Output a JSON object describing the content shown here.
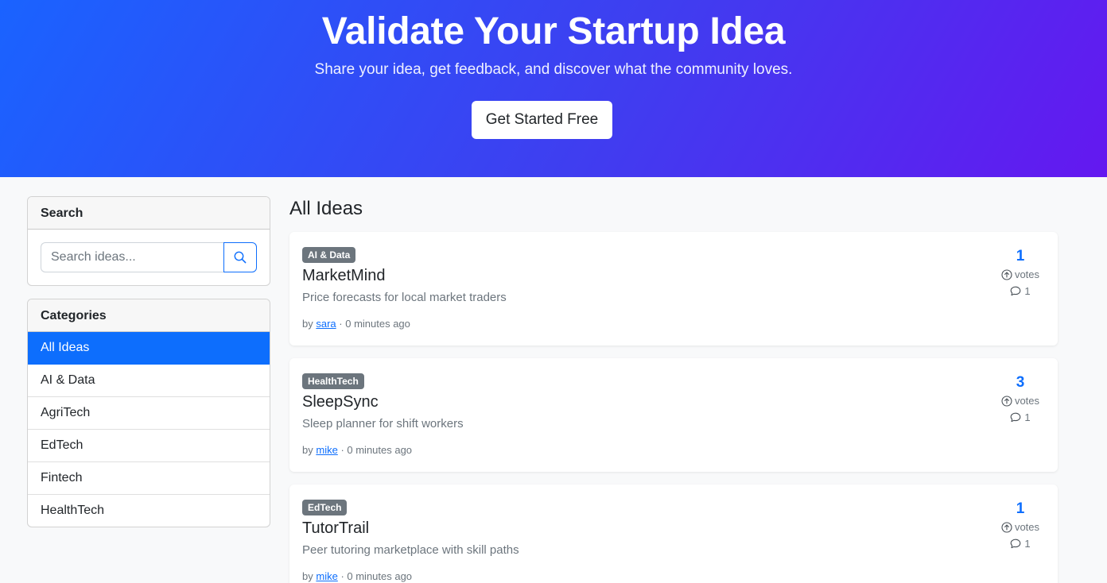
{
  "hero": {
    "title": "Validate Your Startup Idea",
    "subtitle": "Share your idea, get feedback, and discover what the community loves.",
    "cta_label": "Get Started Free"
  },
  "search": {
    "heading": "Search",
    "placeholder": "Search ideas...",
    "icon": "search-icon"
  },
  "categories": {
    "heading": "Categories",
    "items": [
      {
        "label": "All Ideas",
        "active": true
      },
      {
        "label": "AI & Data",
        "active": false
      },
      {
        "label": "AgriTech",
        "active": false
      },
      {
        "label": "EdTech",
        "active": false
      },
      {
        "label": "Fintech",
        "active": false
      },
      {
        "label": "HealthTech",
        "active": false
      }
    ]
  },
  "main": {
    "title": "All Ideas",
    "ideas": [
      {
        "category": "AI & Data",
        "title": "MarketMind",
        "description": "Price forecasts for local market traders",
        "by": "by",
        "author": "sara",
        "time": "· 0 minutes ago",
        "votes": "1",
        "votes_label": "votes",
        "comments": "1"
      },
      {
        "category": "HealthTech",
        "title": "SleepSync",
        "description": "Sleep planner for shift workers",
        "by": "by",
        "author": "mike",
        "time": "· 0 minutes ago",
        "votes": "3",
        "votes_label": "votes",
        "comments": "1"
      },
      {
        "category": "EdTech",
        "title": "TutorTrail",
        "description": "Peer tutoring marketplace with skill paths",
        "by": "by",
        "author": "mike",
        "time": "· 0 minutes ago",
        "votes": "1",
        "votes_label": "votes",
        "comments": "1"
      }
    ]
  },
  "colors": {
    "primary": "#0d6efd",
    "hero_start": "#1a63ff",
    "hero_end": "#6418f0",
    "badge": "#6c757d"
  }
}
